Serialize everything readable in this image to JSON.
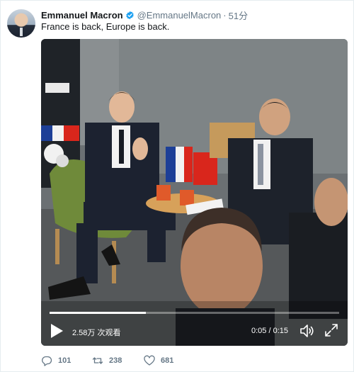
{
  "tweet": {
    "author_name": "Emmanuel Macron",
    "handle": "@EmmanuelMacron",
    "separator": "·",
    "time": "51分",
    "text": "France is back, Europe is back.",
    "verified": true
  },
  "video": {
    "views": "2.58万 次观看",
    "current_time": "0:05",
    "duration": "0:15",
    "time_separator": "/",
    "progress_fraction": 0.333
  },
  "actions": {
    "replies": "101",
    "retweets": "238",
    "likes": "681"
  },
  "colors": {
    "verified": "#1da1f2",
    "muted_text": "#657786",
    "text": "#14171a"
  },
  "icons": {
    "verified": "verified-badge-icon",
    "play": "play-icon",
    "volume": "volume-icon",
    "fullscreen": "fullscreen-icon",
    "reply": "reply-icon",
    "retweet": "retweet-icon",
    "like": "heart-icon"
  }
}
